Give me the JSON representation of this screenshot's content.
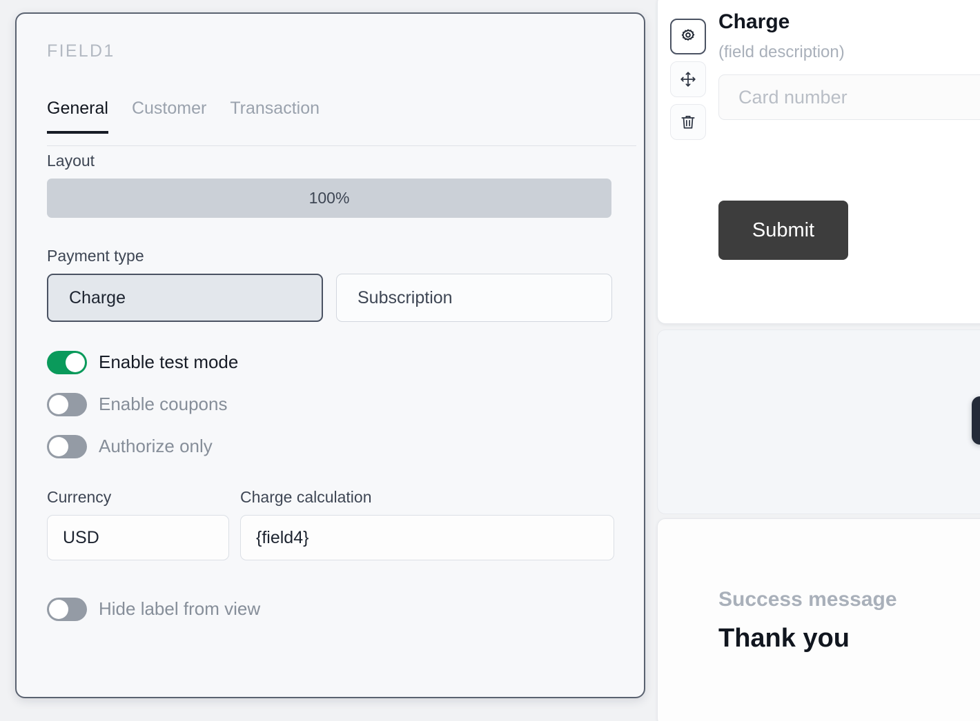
{
  "settings_panel": {
    "field_title": "FIELD1",
    "tabs": [
      {
        "label": "General",
        "active": true
      },
      {
        "label": "Customer",
        "active": false
      },
      {
        "label": "Transaction",
        "active": false
      }
    ],
    "layout": {
      "label": "Layout",
      "value": "100%"
    },
    "payment_type": {
      "label": "Payment type",
      "options": [
        {
          "label": "Charge",
          "selected": true
        },
        {
          "label": "Subscription",
          "selected": false
        }
      ]
    },
    "toggles": [
      {
        "label": "Enable test mode",
        "on": true
      },
      {
        "label": "Enable coupons",
        "on": false
      },
      {
        "label": "Authorize only",
        "on": false
      }
    ],
    "currency": {
      "label": "Currency",
      "value": "USD"
    },
    "charge_calculation": {
      "label": "Charge calculation",
      "value": "{field4}"
    },
    "hide_label": {
      "label": "Hide label from view",
      "on": false
    }
  },
  "preview": {
    "icons": [
      {
        "name": "gear-icon",
        "active": true
      },
      {
        "name": "move-icon",
        "active": false
      },
      {
        "name": "trash-icon",
        "active": false
      }
    ],
    "field_title": "Charge",
    "field_description": "(field description)",
    "card_number_placeholder": "Card number",
    "submit_label": "Submit",
    "success": {
      "label": "Success message",
      "text": "Thank you"
    }
  },
  "colors": {
    "accent_green": "#0a9a5b",
    "submit_dark": "#3d3d3d",
    "panel_border": "#5a6270",
    "dark_pill": "#242b39"
  }
}
